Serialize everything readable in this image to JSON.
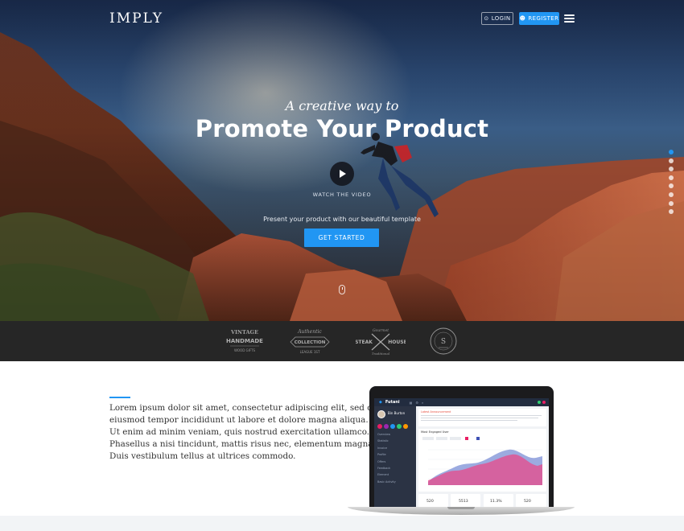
{
  "header": {
    "logo": "IMPLY",
    "login_label": "LOGIN",
    "register_label": "REGISTER"
  },
  "hero": {
    "tagline": "A creative way to",
    "headline": "Promote Your Product",
    "watch_label": "WATCH THE VIDEO",
    "subtext": "Present your product with our beautiful template",
    "cta_label": "GET STARTED",
    "slides": {
      "count": 8,
      "active_index": 0
    }
  },
  "brands": [
    {
      "name": "vintage-handmade",
      "lines": [
        "VINTAGE",
        "HANDMADE",
        "WOOD GIFTS"
      ]
    },
    {
      "name": "authentic-collection",
      "lines": [
        "Authentic",
        "COLLECTION",
        "LEAGUE 1ST"
      ]
    },
    {
      "name": "steak-house",
      "lines": [
        "Gourmet",
        "STEAK",
        "HOUSE"
      ]
    },
    {
      "name": "badge-s",
      "lines": [
        "S"
      ]
    }
  ],
  "content": {
    "paragraph_lines": [
      "Lorem ipsum dolor sit amet, consectetur adipiscing elit, sed do",
      "eiusmod tempor incididunt ut labore et dolore magna aliqua.",
      "Ut enim ad minim veniam, quis nostrud exercitation ullamco.",
      "Phasellus a nisi tincidunt, mattis risus nec, elementum magna.",
      "Duis vestibulum tellus at ultrices commodo."
    ]
  },
  "device_screen": {
    "app_name": "Futani",
    "user_name": "Bin Burton",
    "alert_title": "Latest Announcement",
    "chart_title": "Most Engaged User",
    "menu": [
      "Overview",
      "Statistic",
      "Invoice",
      "Profile",
      "Offers",
      "Feedback",
      "Element",
      "Basic Activity"
    ],
    "stats": [
      {
        "value": "520"
      },
      {
        "value": "5513"
      },
      {
        "value": "11.3%"
      },
      {
        "value": "520"
      }
    ]
  },
  "colors": {
    "accent": "#2196f3",
    "strip": "#262626",
    "text": "#333333"
  }
}
